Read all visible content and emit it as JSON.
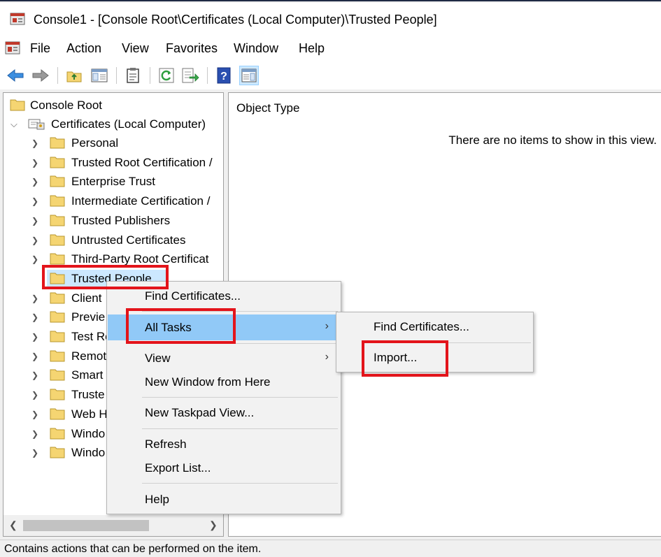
{
  "window": {
    "title": "Console1 - [Console Root\\Certificates (Local Computer)\\Trusted People]"
  },
  "menubar": {
    "items": [
      "File",
      "Action",
      "View",
      "Favorites",
      "Window",
      "Help"
    ]
  },
  "toolbar": {
    "buttons": [
      "back-icon",
      "forward-icon",
      "up-folder-icon",
      "show-hide-tree-icon",
      "properties-icon",
      "refresh-icon",
      "export-list-icon",
      "help-icon",
      "show-action-pane-icon"
    ]
  },
  "tree": {
    "root": "Console Root",
    "certificates": "Certificates (Local Computer)",
    "items": [
      "Personal",
      "Trusted Root Certification Authorities",
      "Enterprise Trust",
      "Intermediate Certification Authorities",
      "Trusted Publishers",
      "Untrusted Certificates",
      "Third-Party Root Certification Authorities",
      "Trusted People",
      "Client Authentication Issuers",
      "Preview Build Roots",
      "Test Roots",
      "Remote Desktop",
      "Smart Card Trusted Roots",
      "Trusted Devices",
      "Web Hosting",
      "Windows Live ID Token Issuer",
      "Windows Server Update Services"
    ],
    "display": [
      "Personal",
      "Trusted Root Certification /",
      "Enterprise Trust",
      "Intermediate Certification /",
      "Trusted Publishers",
      "Untrusted Certificates",
      "Third-Party Root Certificat",
      "Trusted People",
      "Client",
      "Previe",
      "Test Ro",
      "Remot",
      "Smart",
      "Truste",
      "Web H",
      "Windo",
      "Windo"
    ],
    "selected": "Trusted People"
  },
  "result": {
    "column_header": "Object Type",
    "empty_message": "There are no items to show in this view."
  },
  "context_menu": {
    "find_certificates": "Find Certificates...",
    "all_tasks": "All Tasks",
    "view": "View",
    "new_window": "New Window from Here",
    "new_taskpad": "New Taskpad View...",
    "refresh": "Refresh",
    "export_list": "Export List...",
    "help": "Help"
  },
  "submenu": {
    "find_certificates": "Find Certificates...",
    "import": "Import..."
  },
  "statusbar": {
    "text": "Contains actions that can be performed on the item."
  },
  "colors": {
    "highlight_red": "#e3141b",
    "menu_hover": "#91c9f7",
    "tree_selection": "#cce8ff",
    "folder_yellow": "#f5d572"
  }
}
